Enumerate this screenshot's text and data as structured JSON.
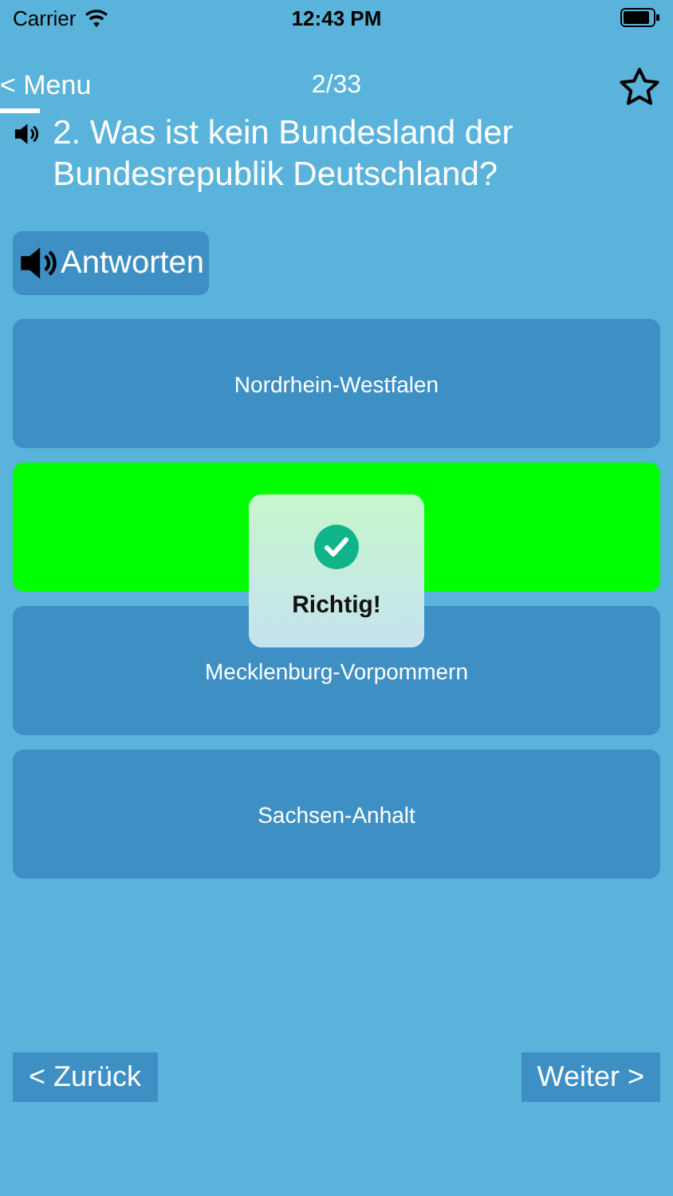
{
  "status_bar": {
    "carrier": "Carrier",
    "time": "12:43 PM"
  },
  "nav": {
    "back": "< Menu",
    "progress": "2/33",
    "favorite": false
  },
  "question": "2. Was ist kein Bundesland der Bundesrepublik Deutschland?",
  "read_answers_button": "Antworten",
  "answers": [
    {
      "label": "Nordrhein-Westfalen",
      "selected": false
    },
    {
      "selected": true
    },
    {
      "label": "Mecklenburg-Vorpommern",
      "selected": false
    },
    {
      "label": "Sachsen-Anhalt",
      "selected": false
    }
  ],
  "feedback": {
    "text": "Richtig!",
    "correct": true
  },
  "footer": {
    "previous": "< Zurück",
    "next": "Weiter >"
  }
}
